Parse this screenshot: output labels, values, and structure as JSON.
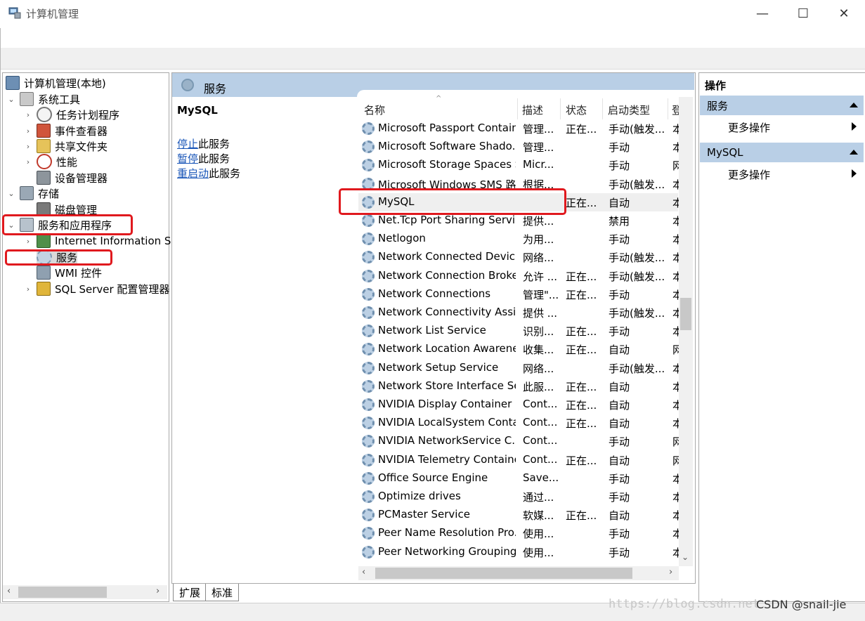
{
  "window": {
    "title": "计算机管理",
    "minimize": "—",
    "maximize": "☐",
    "close": "✕"
  },
  "tree": {
    "items": [
      {
        "label": "计算机管理(本地)",
        "icon": "computer-management-icon"
      },
      {
        "label": "系统工具",
        "icon": "tools-icon"
      },
      {
        "label": "任务计划程序",
        "icon": "clock-icon"
      },
      {
        "label": "事件查看器",
        "icon": "event-viewer-icon"
      },
      {
        "label": "共享文件夹",
        "icon": "shared-folder-icon"
      },
      {
        "label": "性能",
        "icon": "performance-icon"
      },
      {
        "label": "设备管理器",
        "icon": "device-manager-icon"
      },
      {
        "label": "存储",
        "icon": "storage-icon"
      },
      {
        "label": "磁盘管理",
        "icon": "disk-icon"
      },
      {
        "label": "服务和应用程序",
        "icon": "services-apps-icon"
      },
      {
        "label": "Internet Information Se",
        "icon": "iis-icon"
      },
      {
        "label": "服务",
        "icon": "gear-icon"
      },
      {
        "label": "WMI 控件",
        "icon": "wmi-icon"
      },
      {
        "label": "SQL Server 配置管理器",
        "icon": "sql-server-icon"
      }
    ]
  },
  "center": {
    "header": "服务",
    "selected_service": "MySQL",
    "links": [
      {
        "link": "停止",
        "rest": "此服务"
      },
      {
        "link": "暂停",
        "rest": "此服务"
      },
      {
        "link": "重启动",
        "rest": "此服务"
      }
    ],
    "columns": {
      "name": "名称",
      "desc": "描述",
      "status": "状态",
      "startup": "启动类型",
      "login": "登"
    },
    "rows": [
      {
        "name": "Microsoft Passport Container",
        "desc": "管理...",
        "status": "正在...",
        "startup": "手动(触发...",
        "login": "本"
      },
      {
        "name": "Microsoft Software Shado...",
        "desc": "管理...",
        "status": "",
        "startup": "手动",
        "login": "本"
      },
      {
        "name": "Microsoft Storage Spaces S...",
        "desc": "Micr...",
        "status": "",
        "startup": "手动",
        "login": "网"
      },
      {
        "name": "Microsoft Windows SMS 路...",
        "desc": "根据...",
        "status": "",
        "startup": "手动(触发...",
        "login": "本"
      },
      {
        "name": "MySQL",
        "desc": "",
        "status": "正在...",
        "startup": "自动",
        "login": "本"
      },
      {
        "name": "Net.Tcp Port Sharing Service",
        "desc": "提供...",
        "status": "",
        "startup": "禁用",
        "login": "本"
      },
      {
        "name": "Netlogon",
        "desc": "为用...",
        "status": "",
        "startup": "手动",
        "login": "本"
      },
      {
        "name": "Network Connected Devic...",
        "desc": "网络...",
        "status": "",
        "startup": "手动(触发...",
        "login": "本"
      },
      {
        "name": "Network Connection Broker",
        "desc": "允许 ...",
        "status": "正在...",
        "startup": "手动(触发...",
        "login": "本"
      },
      {
        "name": "Network Connections",
        "desc": "管理\"...",
        "status": "正在...",
        "startup": "手动",
        "login": "本"
      },
      {
        "name": "Network Connectivity Assis...",
        "desc": "提供 ...",
        "status": "",
        "startup": "手动(触发...",
        "login": "本"
      },
      {
        "name": "Network List Service",
        "desc": "识别...",
        "status": "正在...",
        "startup": "手动",
        "login": "本"
      },
      {
        "name": "Network Location Awarene...",
        "desc": "收集...",
        "status": "正在...",
        "startup": "自动",
        "login": "网"
      },
      {
        "name": "Network Setup Service",
        "desc": "网络...",
        "status": "",
        "startup": "手动(触发...",
        "login": "本"
      },
      {
        "name": "Network Store Interface Se...",
        "desc": "此服...",
        "status": "正在...",
        "startup": "自动",
        "login": "本"
      },
      {
        "name": "NVIDIA Display Container LS",
        "desc": "Cont...",
        "status": "正在...",
        "startup": "自动",
        "login": "本"
      },
      {
        "name": "NVIDIA LocalSystem Conta...",
        "desc": "Cont...",
        "status": "正在...",
        "startup": "自动",
        "login": "本"
      },
      {
        "name": "NVIDIA NetworkService C...",
        "desc": "Cont...",
        "status": "",
        "startup": "手动",
        "login": "网"
      },
      {
        "name": "NVIDIA Telemetry Container",
        "desc": "Cont...",
        "status": "正在...",
        "startup": "自动",
        "login": "网"
      },
      {
        "name": "Office  Source Engine",
        "desc": "Save...",
        "status": "",
        "startup": "手动",
        "login": "本"
      },
      {
        "name": "Optimize drives",
        "desc": "通过...",
        "status": "",
        "startup": "手动",
        "login": "本"
      },
      {
        "name": "PCMaster Service",
        "desc": "软媒...",
        "status": "正在...",
        "startup": "自动",
        "login": "本"
      },
      {
        "name": "Peer Name Resolution Pro...",
        "desc": "使用...",
        "status": "",
        "startup": "手动",
        "login": "本"
      },
      {
        "name": "Peer Networking Grouping",
        "desc": "使用...",
        "status": "",
        "startup": "手动",
        "login": "本"
      }
    ]
  },
  "tabs": [
    "扩展",
    "标准"
  ],
  "actions": {
    "title": "操作",
    "sections": [
      {
        "label": "服务",
        "item": "更多操作"
      },
      {
        "label": "MySQL",
        "item": "更多操作"
      }
    ]
  },
  "watermark": "https://blog.csdn.net",
  "watermark_credit": "CSDN @snail-jie",
  "colors": {
    "highlight_box": "#e0191e",
    "header_blue": "#b9cfe6",
    "link_blue": "#1a56b8"
  }
}
